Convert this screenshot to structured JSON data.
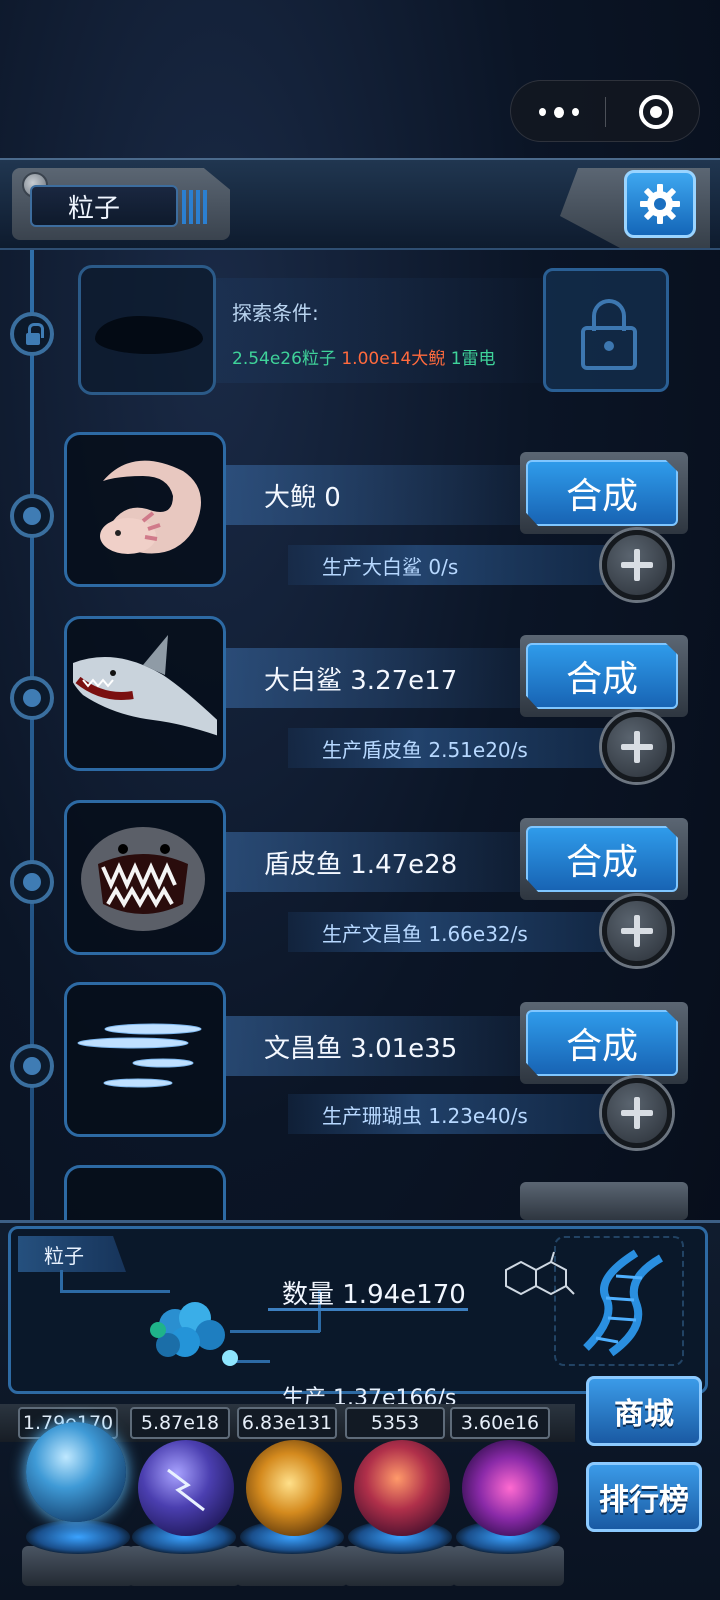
{
  "capsule": {
    "more_icon": "more-dots-icon",
    "close_icon": "target-icon"
  },
  "header": {
    "tab_label": "粒子",
    "settings_icon": "gear-icon"
  },
  "locked": {
    "title": "探索条件:",
    "requirements": [
      {
        "text": "2.54e26粒子",
        "color": "#3fd39a"
      },
      {
        "text": "1.00e14大鲵",
        "color": "#ff6a3d"
      },
      {
        "text": "1雷电",
        "color": "#3fd39a"
      }
    ]
  },
  "creatures": [
    {
      "name": "大鲵 0",
      "production": "生产大白鲨 0/s",
      "button": "合成"
    },
    {
      "name": "大白鲨 3.27e17",
      "production": "生产盾皮鱼 2.51e20/s",
      "button": "合成"
    },
    {
      "name": "盾皮鱼 1.47e28",
      "production": "生产文昌鱼 1.66e32/s",
      "button": "合成"
    },
    {
      "name": "文昌鱼 3.01e35",
      "production": "生产珊瑚虫 1.23e40/s",
      "button": "合成"
    }
  ],
  "resource": {
    "tab": "粒子",
    "amount": "数量 1.94e170",
    "rate": "生产 1.37e166/s"
  },
  "side_buttons": {
    "shop": "商城",
    "rank": "排行榜"
  },
  "stats": [
    "1.79e170",
    "5.87e18",
    "6.83e131",
    "5353",
    "3.60e16"
  ],
  "orbs": [
    "particle-orb-icon",
    "lightning-orb-icon",
    "fire-orb-icon",
    "brain-orb-icon",
    "vortex-orb-icon"
  ],
  "colors": {
    "accent": "#2f9bea",
    "frame": "#2d6aa4",
    "background": "#0b1526"
  }
}
